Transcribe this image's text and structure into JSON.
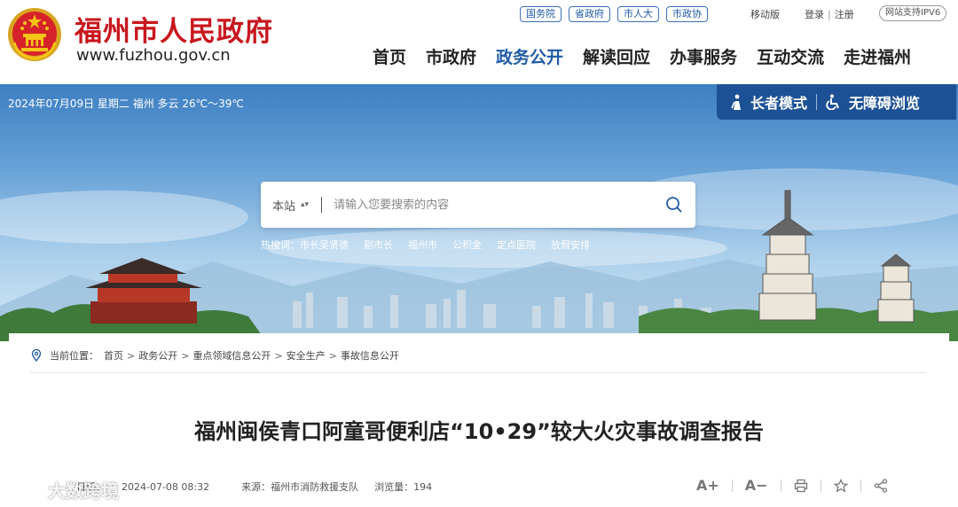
{
  "header": {
    "site_title": "福州市人民政府",
    "site_url": "www.fuzhou.gov.cn",
    "top_links": [
      "国务院",
      "省政府",
      "市人大",
      "市政协"
    ],
    "mobile": "移动版",
    "login": "登录",
    "register": "注册",
    "login_sep": "|",
    "ipv6": "网站支持IPV6",
    "nav": [
      "首页",
      "市政府",
      "政务公开",
      "解读回应",
      "办事服务",
      "互动交流",
      "走进福州"
    ],
    "active_nav": "政务公开"
  },
  "banner": {
    "date_weather": "2024年07月09日 星期二  福州 多云 26℃～39℃",
    "elder_mode": "长者模式",
    "accessible": "无障碍浏览"
  },
  "search": {
    "scope": "本站",
    "placeholder": "请输入您要搜索的内容",
    "hot_label": "热搜词：",
    "hot_words": [
      "市长吴贤德",
      "副市长",
      "福州市",
      "公积金",
      "定点医院",
      "放假安排"
    ]
  },
  "breadcrumb": {
    "label": "当前位置：",
    "items": [
      "首页",
      "政务公开",
      "重点领域信息公开",
      "安全生产",
      "事故信息公开"
    ],
    "separator": ">"
  },
  "article": {
    "title": "福州闽侯青口阿童哥便利店“10•29”较大火灾事故调查报告",
    "date_prefix": "日期：",
    "date": "2024-07-08 08:32",
    "source": "来源：福州市消防救援支队",
    "views": "浏览量：194"
  },
  "tools": {
    "font_up": "A+",
    "font_down": "A−"
  },
  "watermark": "大数跨境",
  "colors": {
    "brand_red": "#c8161d",
    "gov_blue": "#1f5aa6",
    "elder_bg": "#1d5196"
  },
  "icons": [
    "emblem-icon",
    "elder-icon",
    "wheelchair-icon",
    "search-icon",
    "location-icon",
    "print-icon",
    "star-icon",
    "share-icon"
  ]
}
